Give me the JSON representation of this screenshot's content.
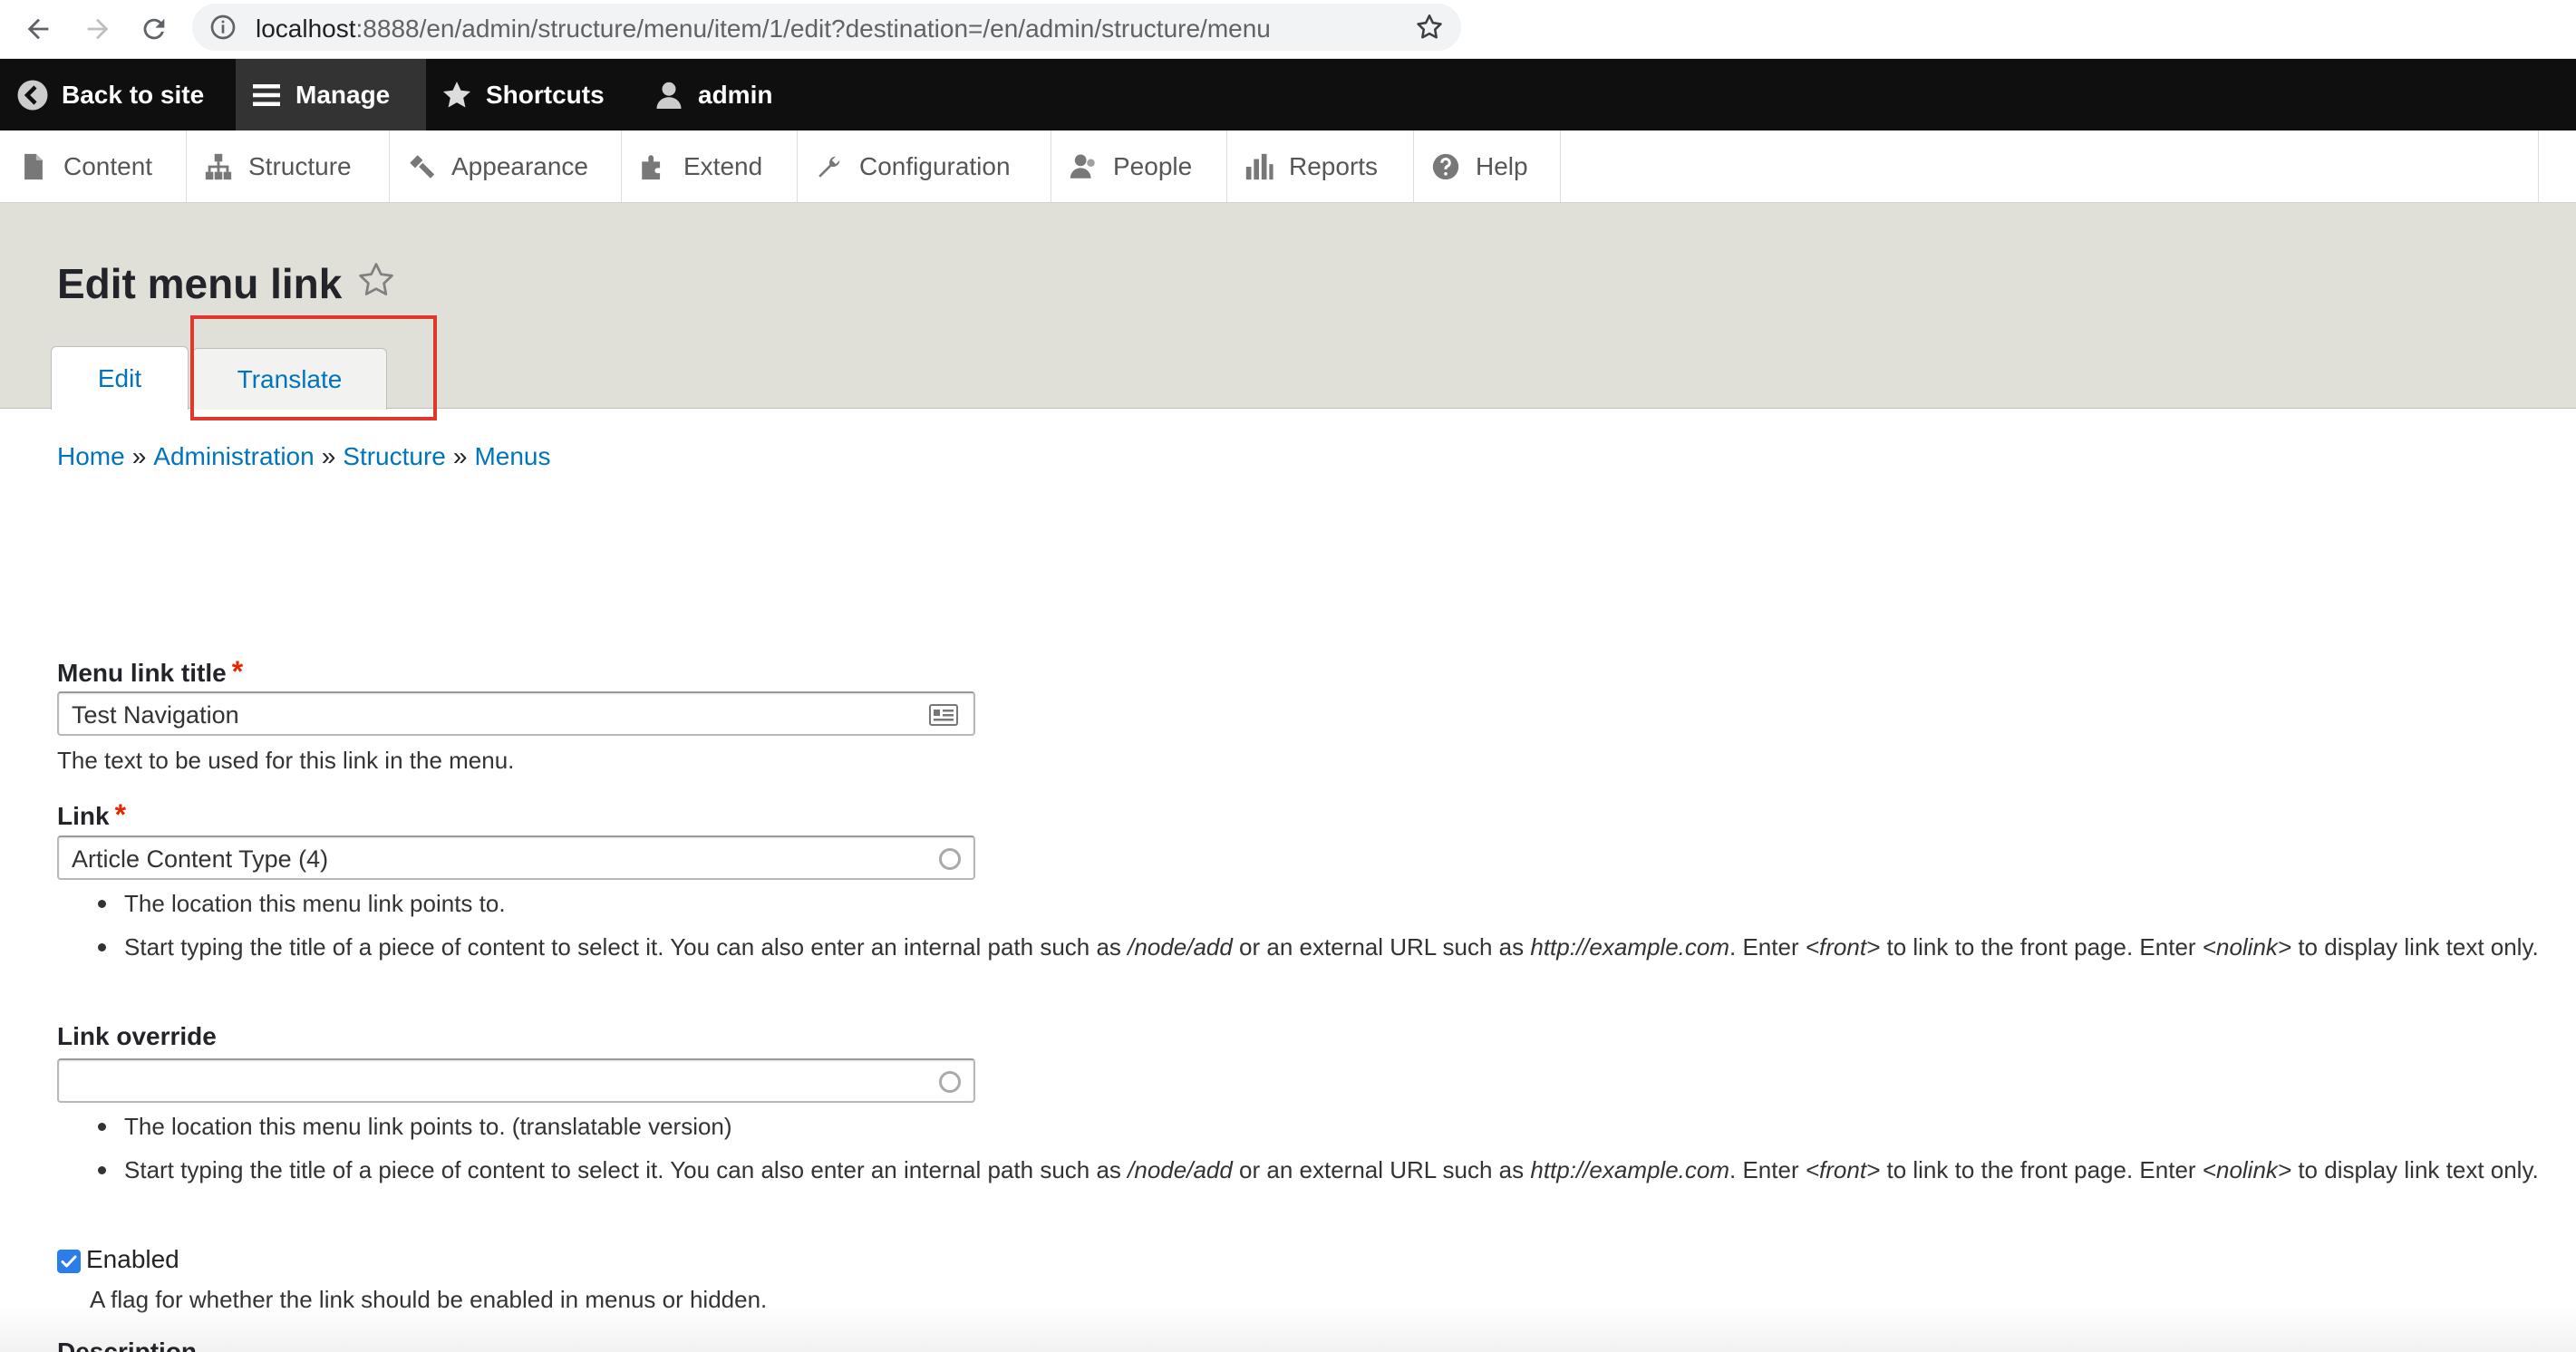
{
  "browser": {
    "url_host": "localhost",
    "url_rest": ":8888/en/admin/structure/menu/item/1/edit?destination=/en/admin/structure/menu"
  },
  "toolbar": {
    "back_to_site": "Back to site",
    "manage": "Manage",
    "shortcuts": "Shortcuts",
    "user": "admin"
  },
  "tray": {
    "items": [
      {
        "label": "Content",
        "icon": "file-icon"
      },
      {
        "label": "Structure",
        "icon": "sitemap-icon"
      },
      {
        "label": "Appearance",
        "icon": "paintbrush-icon"
      },
      {
        "label": "Extend",
        "icon": "puzzle-icon"
      },
      {
        "label": "Configuration",
        "icon": "wrench-icon"
      },
      {
        "label": "People",
        "icon": "people-icon"
      },
      {
        "label": "Reports",
        "icon": "bar-chart-icon"
      },
      {
        "label": "Help",
        "icon": "help-icon"
      }
    ]
  },
  "page": {
    "title": "Edit menu link",
    "tabs": [
      {
        "label": "Edit",
        "active": true
      },
      {
        "label": "Translate",
        "active": false
      }
    ]
  },
  "breadcrumb": {
    "items": [
      "Home",
      "Administration",
      "Structure",
      "Menus"
    ],
    "separator": "»"
  },
  "form": {
    "menu_link_title": {
      "label": "Menu link title",
      "required_mark": "*",
      "value": "Test Navigation",
      "description": "The text to be used for this link in the menu."
    },
    "link": {
      "label": "Link",
      "required_mark": "*",
      "value": "Article Content Type (4)",
      "help_1": "The location this menu link points to.",
      "help_2_a": "Start typing the title of a piece of content to select it. You can also enter an internal path such as ",
      "help_2_b": "/node/add",
      "help_2_c": " or an external URL such as ",
      "help_2_d": "http://example.com",
      "help_2_e": ". Enter ",
      "help_2_f": "<front>",
      "help_2_g": " to link to the front page. Enter ",
      "help_2_h": "<nolink>",
      "help_2_i": " to display link text only."
    },
    "link_override": {
      "label": "Link override",
      "value": "",
      "help_1": "The location this menu link points to. (translatable version)",
      "help_2_a": "Start typing the title of a piece of content to select it. You can also enter an internal path such as ",
      "help_2_b": "/node/add",
      "help_2_c": " or an external URL such as ",
      "help_2_d": "http://example.com",
      "help_2_e": ". Enter ",
      "help_2_f": "<front>",
      "help_2_g": " to link to the front page. Enter ",
      "help_2_h": "<nolink>",
      "help_2_i": " to display link text only."
    },
    "enabled": {
      "label": "Enabled",
      "checked": true,
      "description": "A flag for whether the link should be enabled in menus or hidden."
    },
    "description_label": "Description"
  },
  "colors": {
    "link": "#0074bd",
    "toolbar_bg": "#0f0f0f",
    "header_bg": "#e0e0d8",
    "highlight": "#e0362b",
    "required": "#e32700",
    "checkbox": "#2b7de9"
  }
}
